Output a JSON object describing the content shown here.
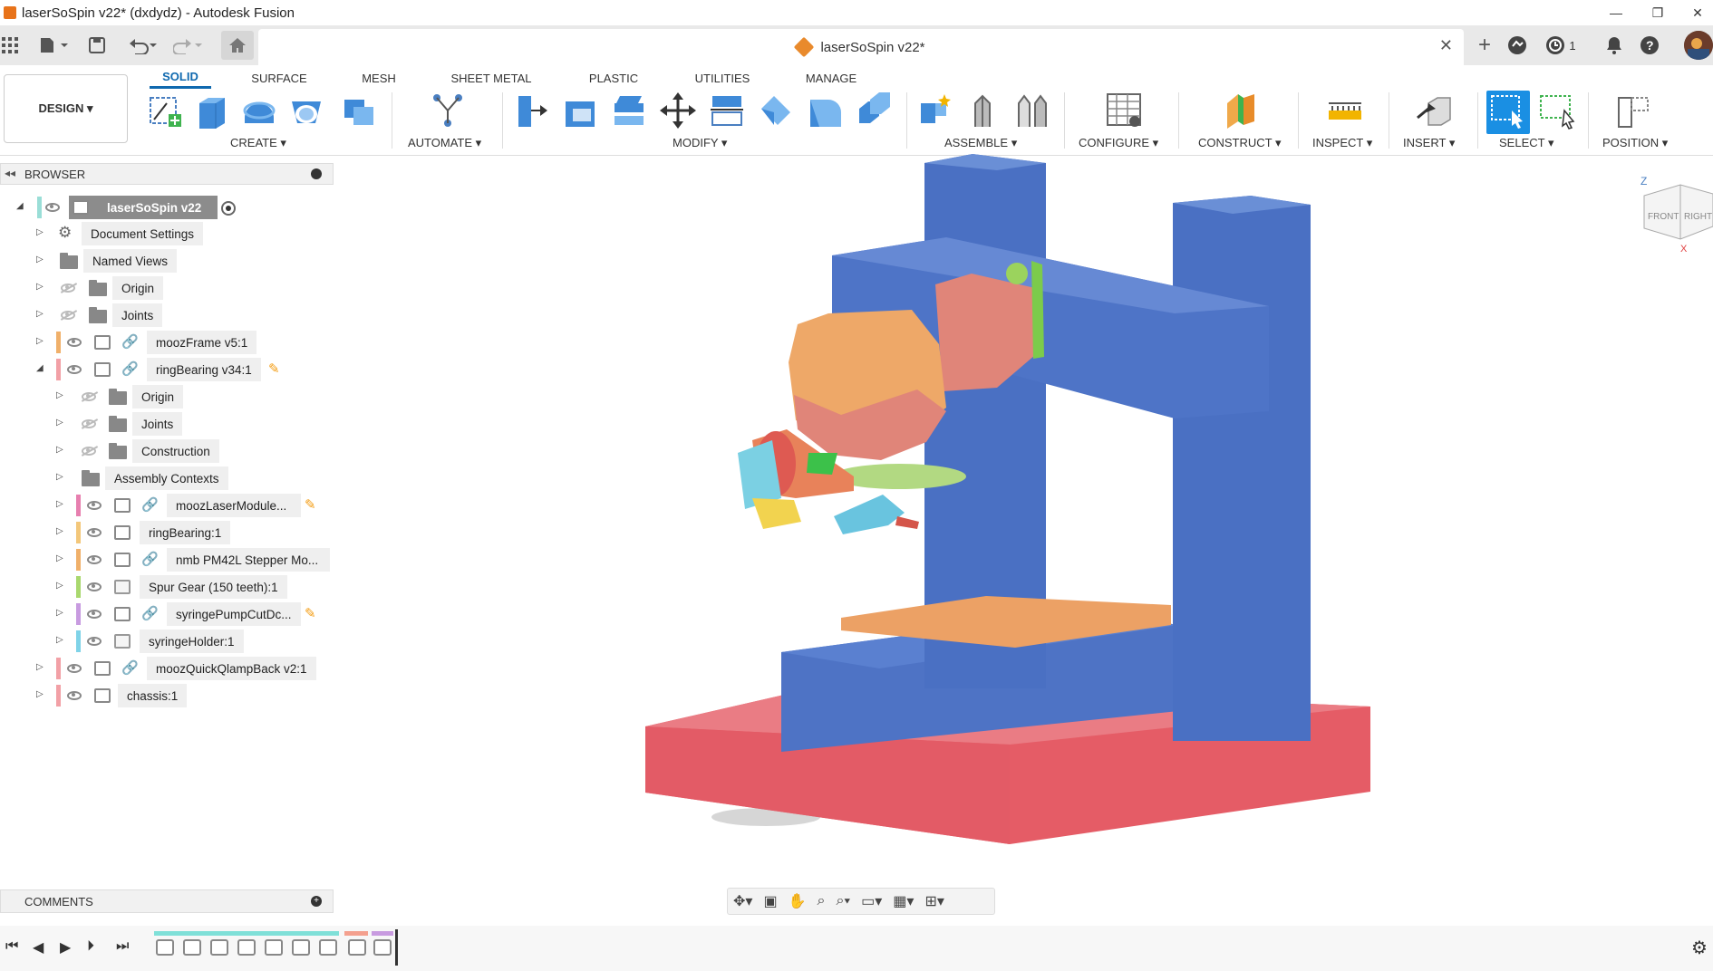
{
  "window": {
    "title": "laserSoSpin v22* (dxdydz) - Autodesk Fusion",
    "controls": [
      "—",
      "❐",
      "✕"
    ]
  },
  "doc_tab": {
    "title": "laserSoSpin v22*"
  },
  "qa": {
    "job_count": "1"
  },
  "ribbon": {
    "design_label": "DESIGN ▾",
    "tabs": [
      "SOLID",
      "SURFACE",
      "MESH",
      "SHEET METAL",
      "PLASTIC",
      "UTILITIES",
      "MANAGE"
    ],
    "groups": [
      "CREATE ▾",
      "AUTOMATE ▾",
      "MODIFY ▾",
      "ASSEMBLE ▾",
      "CONFIGURE ▾",
      "CONSTRUCT ▾",
      "INSPECT ▾",
      "INSERT ▾",
      "SELECT ▾",
      "POSITION ▾"
    ]
  },
  "browser": {
    "title": "BROWSER",
    "root": "laserSoSpin v22",
    "items": [
      "Document Settings",
      "Named Views",
      "Origin",
      "Joints",
      "moozFrame v5:1",
      "ringBearing v34:1",
      "Origin",
      "Joints",
      "Construction",
      "Assembly Contexts",
      "moozLaserModule...",
      "ringBearing:1",
      "nmb PM42L Stepper Mo...",
      "Spur Gear (150 teeth):1",
      "syringePumpCutDc...",
      "syringeHolder:1",
      "moozQuickQlampBack v2:1",
      "chassis:1"
    ]
  },
  "comments": {
    "title": "COMMENTS"
  },
  "viewcube": {
    "axis": "Z",
    "front": "FRONT",
    "right": "RIGHT",
    "x": "X"
  },
  "colors": {
    "accent": "#0f69af",
    "frame_blue": "#4b72c4",
    "base_red": "#e55c66",
    "module_orange": "#eca165",
    "laser_salmon": "#e0877b"
  }
}
